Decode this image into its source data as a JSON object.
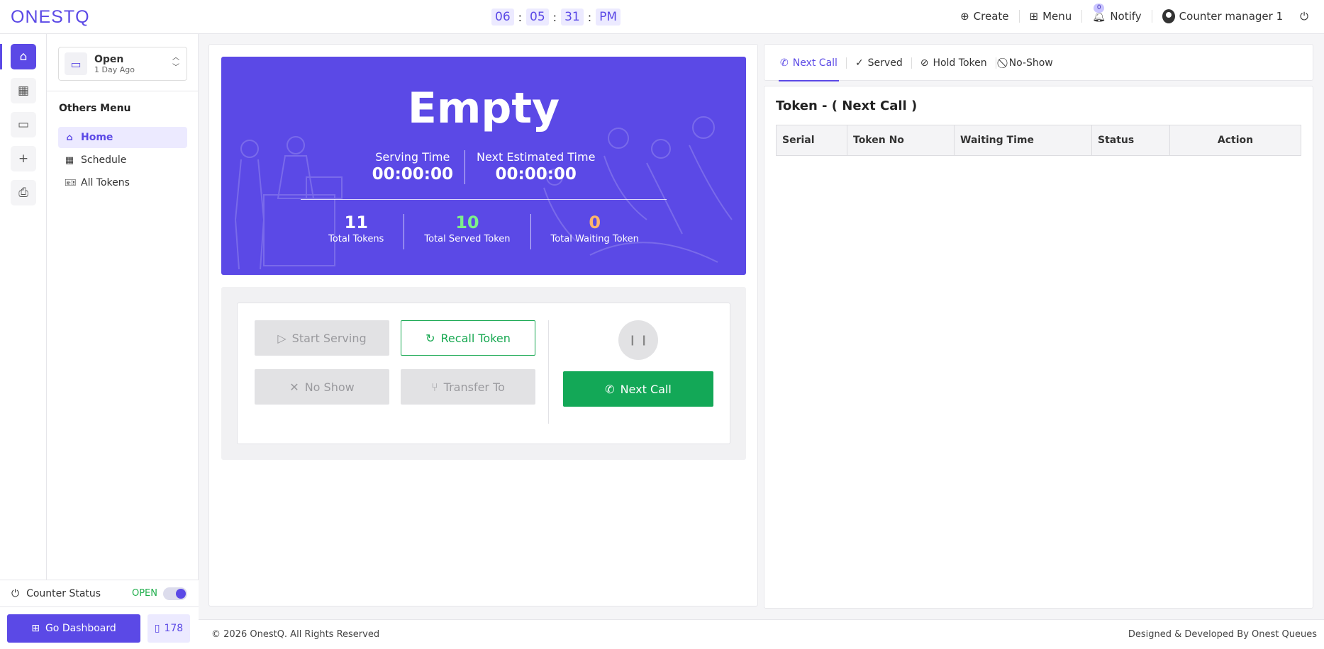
{
  "brand": {
    "logo": "ONESTQ"
  },
  "clock": {
    "hours": "06",
    "minutes": "05",
    "seconds": "31",
    "period": "PM"
  },
  "topnav": {
    "create": "Create",
    "menu": "Menu",
    "notify": "Notify",
    "notify_count": "0",
    "user": "Counter manager 1"
  },
  "sidebar": {
    "status": {
      "title": "Open",
      "subtitle": "1 Day Ago"
    },
    "others_title": "Others Menu",
    "items": [
      {
        "label": "Home",
        "icon": "home-icon"
      },
      {
        "label": "Schedule",
        "icon": "calendar-icon"
      },
      {
        "label": "All Tokens",
        "icon": "ticket-icon"
      }
    ],
    "counter_status_label": "Counter Status",
    "counter_status_value": "OPEN",
    "go_dashboard": "Go Dashboard",
    "counter_count": "178"
  },
  "hero": {
    "title": "Empty",
    "serving_time_label": "Serving Time",
    "serving_time": "00:00:00",
    "next_time_label": "Next Estimated Time",
    "next_time": "00:00:00",
    "total_tokens": "11",
    "total_tokens_label": "Total Tokens",
    "total_served": "10",
    "total_served_label": "Total Served Token",
    "total_waiting": "0",
    "total_waiting_label": "Total Waiting Token"
  },
  "controls": {
    "start_serving": "Start Serving",
    "recall_token": "Recall Token",
    "no_show": "No Show",
    "transfer_to": "Transfer To",
    "next_call": "Next Call"
  },
  "tabs": [
    "Next Call",
    "Served",
    "Hold Token",
    "No-Show"
  ],
  "token_panel": {
    "title": "Token - ( Next Call )",
    "columns": [
      "Serial",
      "Token No",
      "Waiting Time",
      "Status",
      "Action"
    ]
  },
  "footer": {
    "copyright": "© 2026 OnestQ. All Rights Reserved",
    "credit": "Designed & Developed By Onest Queues"
  },
  "colors": {
    "primary": "#5b49e6",
    "success": "#13a857",
    "served": "#7cf08a",
    "waiting": "#ffb56b"
  }
}
